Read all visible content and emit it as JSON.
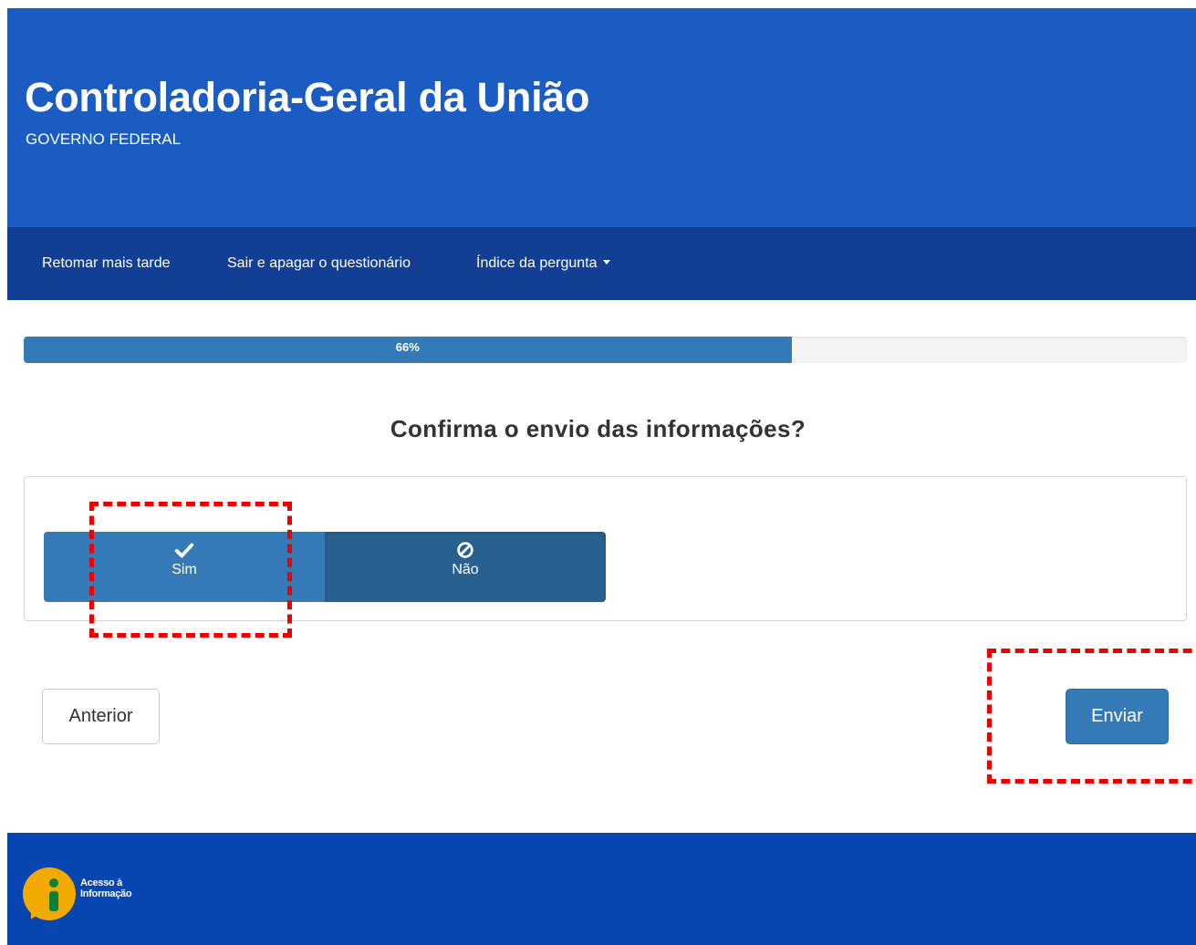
{
  "header": {
    "title": "Controladoria-Geral da União",
    "subtitle": "GOVERNO FEDERAL",
    "background": "#1a5cc2"
  },
  "nav": {
    "items": [
      {
        "label": "Retomar mais tarde"
      },
      {
        "label": "Sair e apagar o questionário"
      },
      {
        "label": "Índice da pergunta",
        "icon": "caret-down-icon"
      }
    ],
    "background": "#123f93"
  },
  "progress": {
    "label": "66%",
    "fill_fraction": 0.66,
    "color": "#337ab7"
  },
  "question": {
    "text": "Confirma o envio das informações?"
  },
  "answers": {
    "options": [
      {
        "label": "Sim",
        "icon": "check-icon",
        "color": "#337ab7"
      },
      {
        "label": "Não",
        "icon": "ban-icon",
        "color": "#286090",
        "selected": true
      }
    ]
  },
  "buttons": {
    "previous": "Anterior",
    "submit": "Enviar"
  },
  "footer": {
    "logo_text_line1": "Acesso à",
    "logo_text_line2": "Informação",
    "logo_icon": "information-icon",
    "background": "#0745b0"
  },
  "annotations": {
    "highlight_color": "#ee0000"
  }
}
